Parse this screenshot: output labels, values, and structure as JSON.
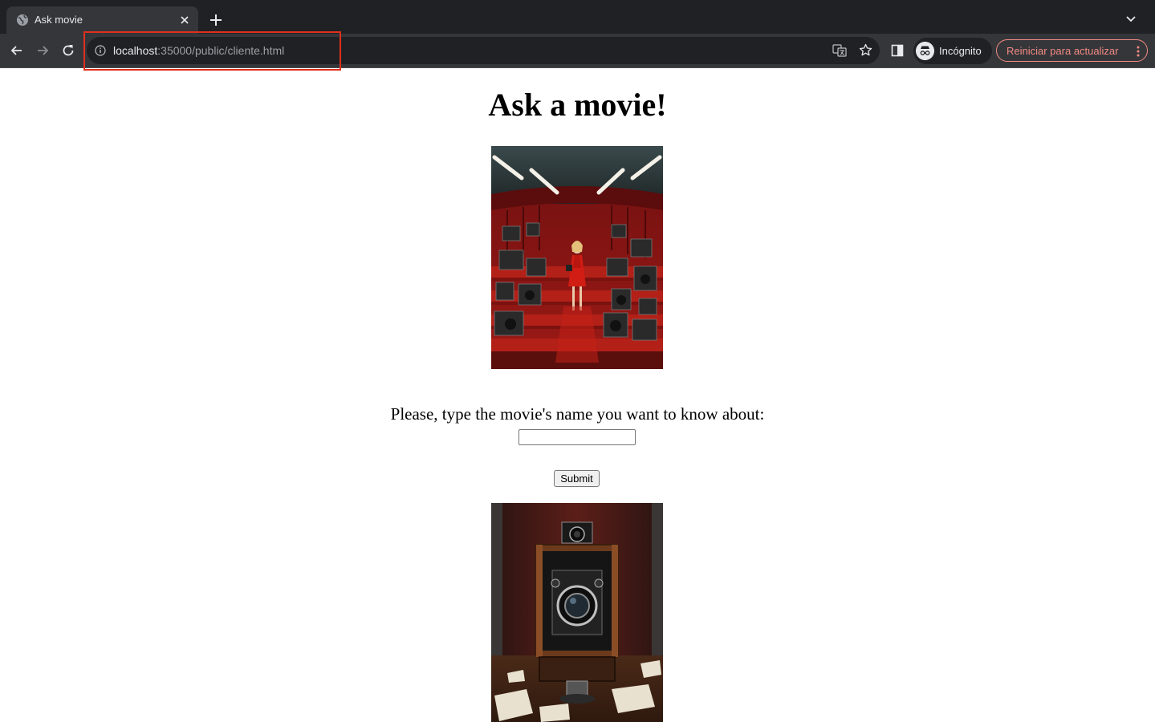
{
  "browser": {
    "tab": {
      "title": "Ask movie"
    },
    "address_bar": {
      "host": "localhost",
      "path": ":35000/public/cliente.html"
    },
    "profile": {
      "label": "Incógnito"
    },
    "update_button": {
      "label": "Reiniciar para actualizar"
    },
    "icons": {
      "favicon": "globe-icon",
      "tab_close": "close-icon",
      "new_tab": "plus-icon",
      "tab_search": "chevron-down-icon",
      "back": "arrow-left-icon",
      "forward": "arrow-right-icon",
      "reload": "reload-icon",
      "site_info": "info-icon",
      "translate": "translate-icon",
      "bookmark": "star-icon",
      "side_panel": "side-panel-icon",
      "incognito": "incognito-icon",
      "menu": "kebab-menu-icon"
    },
    "colors": {
      "tabstrip": "#202124",
      "toolbar": "#35363a",
      "update_accent": "#f28b82",
      "highlight_box": "#e0301e"
    }
  },
  "page": {
    "title": "Ask a movie!",
    "prompt": "Please, type the movie's name you want to know about:",
    "movie_input_value": "",
    "submit_label": "Submit",
    "images": {
      "hero": "cinema-cameras-photo",
      "footer": "vintage-camera-photo"
    }
  }
}
